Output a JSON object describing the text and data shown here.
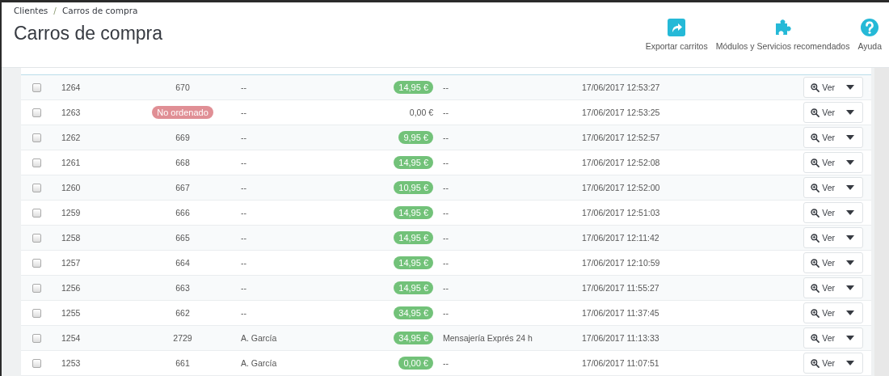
{
  "breadcrumb": [
    "Clientes",
    "Carros de compra"
  ],
  "breadcrumb_separator": "/",
  "title": "Carros de compra",
  "toolbar": [
    {
      "kind": "export",
      "label": "Exportar carritos"
    },
    {
      "kind": "modules",
      "label": "Módulos y Servicios recomendados"
    },
    {
      "kind": "help",
      "label": "Ayuda"
    }
  ],
  "rows": [
    {
      "checked": false,
      "id": "1264",
      "order": {
        "kind": "text",
        "text": "670"
      },
      "customer": "--",
      "total": {
        "kind": "badge",
        "text": "14,95 €"
      },
      "carrier": "--",
      "date": "17/06/2017 12:53:27",
      "action": "Ver"
    },
    {
      "checked": false,
      "id": "1263",
      "order": {
        "kind": "badge",
        "text": "No ordenado"
      },
      "customer": "--",
      "total": {
        "kind": "text",
        "text": "0,00 €"
      },
      "carrier": "--",
      "date": "17/06/2017 12:53:25",
      "action": "Ver"
    },
    {
      "checked": false,
      "id": "1262",
      "order": {
        "kind": "text",
        "text": "669"
      },
      "customer": "--",
      "total": {
        "kind": "badge",
        "text": "9,95 €"
      },
      "carrier": "--",
      "date": "17/06/2017 12:52:57",
      "action": "Ver"
    },
    {
      "checked": false,
      "id": "1261",
      "order": {
        "kind": "text",
        "text": "668"
      },
      "customer": "--",
      "total": {
        "kind": "badge",
        "text": "14,95 €"
      },
      "carrier": "--",
      "date": "17/06/2017 12:52:08",
      "action": "Ver"
    },
    {
      "checked": false,
      "id": "1260",
      "order": {
        "kind": "text",
        "text": "667"
      },
      "customer": "--",
      "total": {
        "kind": "badge",
        "text": "10,95 €"
      },
      "carrier": "--",
      "date": "17/06/2017 12:52:00",
      "action": "Ver"
    },
    {
      "checked": false,
      "id": "1259",
      "order": {
        "kind": "text",
        "text": "666"
      },
      "customer": "--",
      "total": {
        "kind": "badge",
        "text": "14,95 €"
      },
      "carrier": "--",
      "date": "17/06/2017 12:51:03",
      "action": "Ver"
    },
    {
      "checked": false,
      "id": "1258",
      "order": {
        "kind": "text",
        "text": "665"
      },
      "customer": "--",
      "total": {
        "kind": "badge",
        "text": "14,95 €"
      },
      "carrier": "--",
      "date": "17/06/2017 12:11:42",
      "action": "Ver"
    },
    {
      "checked": false,
      "id": "1257",
      "order": {
        "kind": "text",
        "text": "664"
      },
      "customer": "--",
      "total": {
        "kind": "badge",
        "text": "14,95 €"
      },
      "carrier": "--",
      "date": "17/06/2017 12:10:59",
      "action": "Ver"
    },
    {
      "checked": false,
      "id": "1256",
      "order": {
        "kind": "text",
        "text": "663"
      },
      "customer": "--",
      "total": {
        "kind": "badge",
        "text": "14,95 €"
      },
      "carrier": "--",
      "date": "17/06/2017 11:55:27",
      "action": "Ver"
    },
    {
      "checked": false,
      "id": "1255",
      "order": {
        "kind": "text",
        "text": "662"
      },
      "customer": "--",
      "total": {
        "kind": "badge",
        "text": "34,95 €"
      },
      "carrier": "--",
      "date": "17/06/2017 11:37:45",
      "action": "Ver"
    },
    {
      "checked": false,
      "id": "1254",
      "order": {
        "kind": "text",
        "text": "2729"
      },
      "customer": "A. García",
      "total": {
        "kind": "badge",
        "text": "34,95 €"
      },
      "carrier": "Mensajería Exprés 24 h",
      "date": "17/06/2017 11:13:33",
      "action": "Ver"
    },
    {
      "checked": false,
      "id": "1253",
      "order": {
        "kind": "text",
        "text": "661"
      },
      "customer": "A. García",
      "total": {
        "kind": "badge",
        "text": "0,00 €"
      },
      "carrier": "--",
      "date": "17/06/2017 11:07:51",
      "action": "Ver"
    }
  ]
}
